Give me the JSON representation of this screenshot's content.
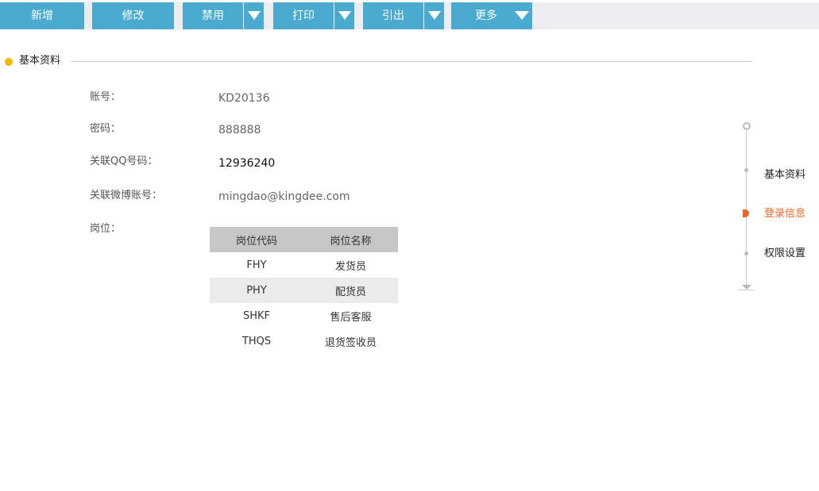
{
  "toolbar": {
    "add_label": "新增",
    "edit_label": "修改",
    "disable_label": "禁用",
    "print_label": "打印",
    "export_label": "引出",
    "more_label": "更多"
  },
  "section": {
    "title": "基本资料"
  },
  "form": {
    "account_label": "账号：",
    "account_value": "KD20136",
    "password_label": "密码：",
    "password_value": "888888",
    "qq_label": "关联QQ号码：",
    "qq_value": "12936240",
    "weibo_label": "关联微博账号：",
    "weibo_value": "mingdao@kingdee.com",
    "position_label": "岗位："
  },
  "positions": {
    "headers": [
      "岗位代码",
      "岗位名称"
    ],
    "rows": [
      {
        "code": "FHY",
        "name": "发货员"
      },
      {
        "code": "PHY",
        "name": "配货员"
      },
      {
        "code": "SHKF",
        "name": "售后客服"
      },
      {
        "code": "THQS",
        "name": "退货签收员"
      }
    ]
  },
  "side_nav": {
    "items": [
      {
        "label": "基本资料",
        "active": false
      },
      {
        "label": "登录信息",
        "active": true
      },
      {
        "label": "权限设置",
        "active": false
      }
    ]
  },
  "colors": {
    "toolbar_button": "#4aaad0",
    "section_dot": "#f2b900",
    "active_nav": "#f26522"
  }
}
